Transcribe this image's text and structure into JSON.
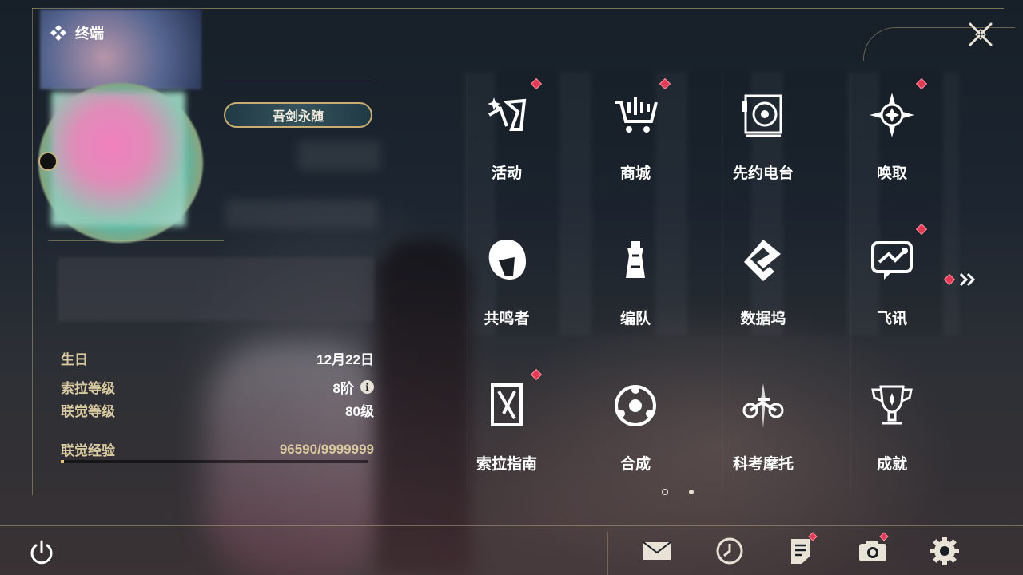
{
  "header": {
    "title": "终端",
    "title_icon": "diamond-cluster-icon",
    "close_icon": "close-icon"
  },
  "profile": {
    "title_badge": "吾剑永随",
    "stats": [
      {
        "key": "生日",
        "value": "12月22日"
      },
      {
        "key": "索拉等级",
        "value": "8阶",
        "info_icon": "i"
      },
      {
        "key": "联觉等级",
        "value": "80级"
      },
      {
        "key": "联觉经验",
        "value": "96590/9999999"
      }
    ],
    "exp_progress": 0.0097
  },
  "menu": {
    "items": [
      {
        "label": "活动",
        "icon": "event-icon",
        "badge": true
      },
      {
        "label": "商城",
        "icon": "shop-cart-icon",
        "badge": true
      },
      {
        "label": "先约电台",
        "icon": "radio-icon",
        "badge": false
      },
      {
        "label": "唤取",
        "icon": "gacha-star-icon",
        "badge": true
      },
      {
        "label": "共鸣者",
        "icon": "resonator-icon",
        "badge": false
      },
      {
        "label": "编队",
        "icon": "team-chess-icon",
        "badge": false
      },
      {
        "label": "数据坞",
        "icon": "data-bank-icon",
        "badge": false
      },
      {
        "label": "飞讯",
        "icon": "chat-icon",
        "badge": true
      },
      {
        "label": "索拉指南",
        "icon": "guide-icon",
        "badge": true
      },
      {
        "label": "合成",
        "icon": "synthesis-icon",
        "badge": false
      },
      {
        "label": "科考摩托",
        "icon": "motorbike-icon",
        "badge": false
      },
      {
        "label": "成就",
        "icon": "trophy-icon",
        "badge": false
      }
    ],
    "next_page_icon": "double-chevron-right-icon",
    "pages": 2,
    "current_page": 1
  },
  "bottom_bar": {
    "power_icon": "power-icon",
    "tools": [
      {
        "name": "mail-button",
        "icon": "mail-icon",
        "badge": false
      },
      {
        "name": "clock-button",
        "icon": "clock-icon",
        "badge": false
      },
      {
        "name": "notice-button",
        "icon": "notice-icon",
        "badge": true
      },
      {
        "name": "camera-button",
        "icon": "camera-icon",
        "badge": true
      },
      {
        "name": "settings-button",
        "icon": "gear-icon",
        "badge": false
      }
    ]
  },
  "colors": {
    "accent_gold": "#c9ae74",
    "badge_red": "#e23b55",
    "label_gold": "#d9c9a1"
  }
}
